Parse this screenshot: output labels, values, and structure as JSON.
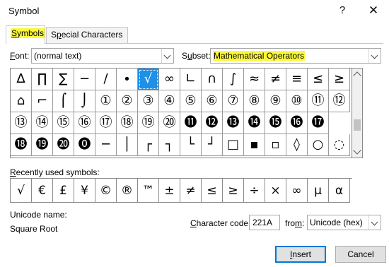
{
  "window": {
    "title": "Symbol",
    "help_label": "?",
    "close_label": "✕"
  },
  "tabs": [
    {
      "prefix": "",
      "accel": "S",
      "rest": "ymbols",
      "active": true
    },
    {
      "prefix": "S",
      "accel": "p",
      "rest": "ecial Characters",
      "active": false
    }
  ],
  "font": {
    "label_accel": "F",
    "label_rest": "ont:",
    "value": "(normal text)"
  },
  "subset": {
    "label_prefix": "S",
    "label_accel": "u",
    "label_rest": "bset:",
    "value": "Mathematical Operators"
  },
  "symbol_grid": {
    "selected_index": 6,
    "rows": [
      [
        "∆",
        "∏",
        "∑",
        "−",
        "∕",
        "∙",
        "√",
        "∞",
        "∟",
        "∩",
        "∫",
        "≈",
        "≠",
        "≡",
        "≤",
        "≥"
      ],
      [
        "⌂",
        "⌐",
        "⌠",
        "⌡",
        "①",
        "②",
        "③",
        "④",
        "⑤",
        "⑥",
        "⑦",
        "⑧",
        "⑨",
        "⑩",
        "⑪",
        "⑫"
      ],
      [
        "⑬",
        "⑭",
        "⑮",
        "⑯",
        "⑰",
        "⑱",
        "⑲",
        "⑳",
        "⓫",
        "⓬",
        "⓭",
        "⓮",
        "⓯",
        "⓰",
        "⓱"
      ],
      [
        "⓲",
        "⓳",
        "⓴",
        "⓿",
        "─",
        "│",
        "┌",
        "┐",
        "└",
        "┘",
        "□",
        "▪",
        "▫",
        "◊",
        "○",
        "◌"
      ]
    ]
  },
  "recent": {
    "label_accel": "R",
    "label_rest": "ecently used symbols:",
    "symbols": [
      "√",
      "€",
      "£",
      "¥",
      "©",
      "®",
      "™",
      "±",
      "≠",
      "≤",
      "≥",
      "÷",
      "×",
      "∞",
      "µ",
      "α"
    ]
  },
  "unicode_name": {
    "label": "Unicode name:",
    "value": "Square Root"
  },
  "char_code": {
    "label_accel": "C",
    "label_rest": "haracter code:",
    "value": "221A"
  },
  "from": {
    "label_prefix": "fro",
    "label_accel": "m",
    "label_rest": ":",
    "value": "Unicode (hex)"
  },
  "buttons": {
    "insert_accel": "I",
    "insert_rest": "nsert",
    "cancel": "Cancel"
  }
}
